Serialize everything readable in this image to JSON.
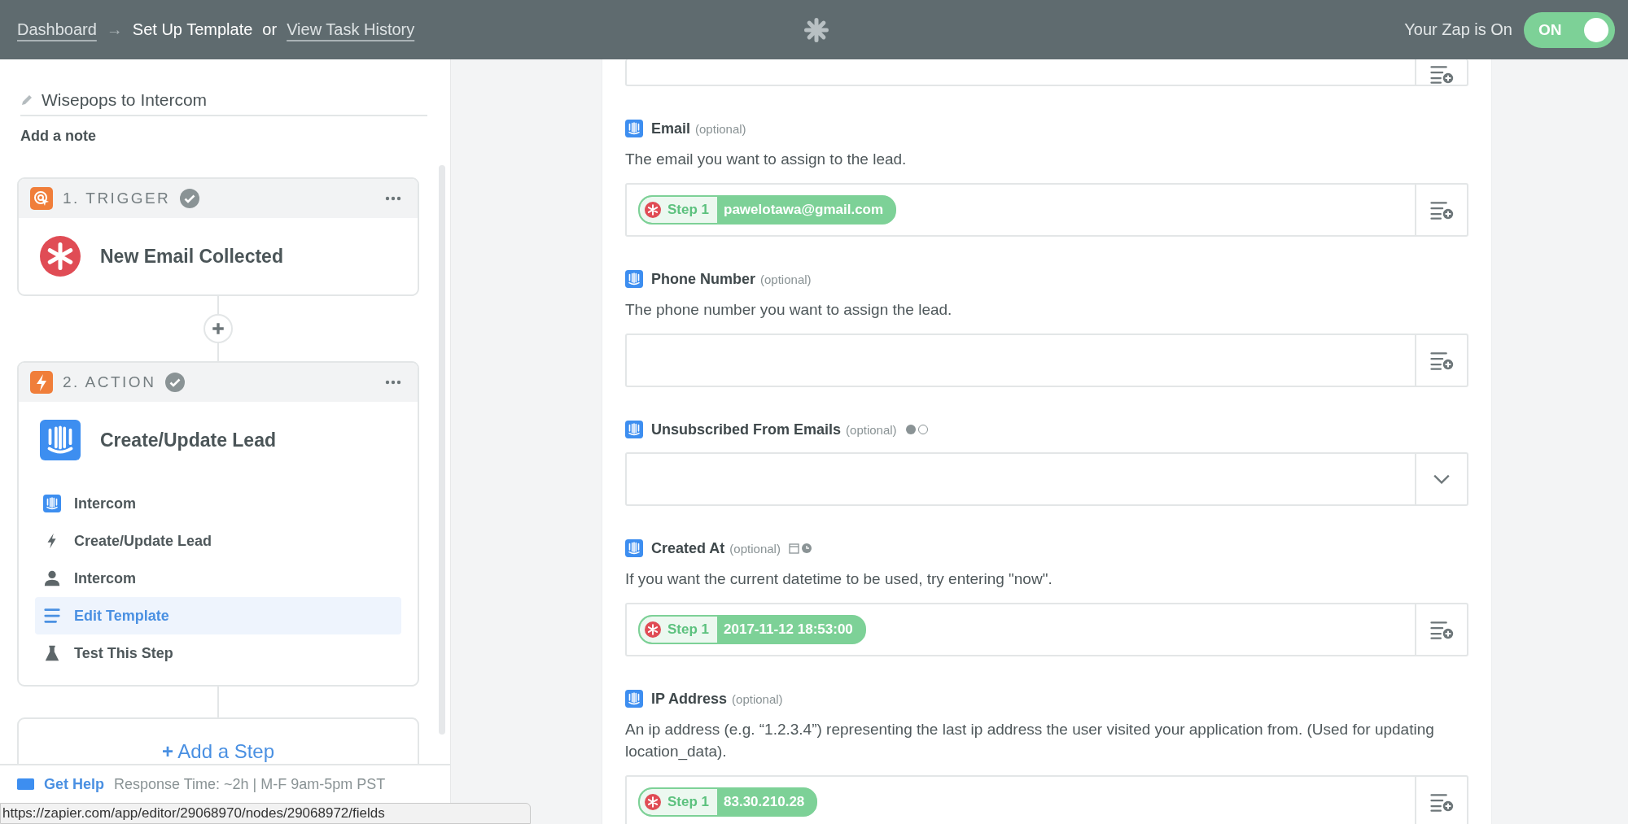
{
  "header": {
    "breadcrumb": [
      {
        "label": "Dashboard",
        "kind": "link"
      },
      {
        "label": "→",
        "kind": "separator"
      },
      {
        "label": "Set Up Template",
        "kind": "current"
      },
      {
        "label": "or",
        "kind": "text"
      },
      {
        "label": "View Task History",
        "kind": "link"
      }
    ],
    "status_label": "Your Zap is On",
    "toggle": {
      "label": "ON",
      "on": true
    }
  },
  "sidebar": {
    "zap_name": "Wisepops to Intercom",
    "note_link": "Add a note",
    "steps": [
      {
        "number_label": "1. TRIGGER",
        "kind": "trigger",
        "complete": true,
        "title": "New Email Collected"
      },
      {
        "number_label": "2. ACTION",
        "kind": "action",
        "complete": true,
        "title": "Create/Update Lead",
        "items": [
          {
            "label": "Intercom",
            "selected": false
          },
          {
            "label": "Create/Update Lead",
            "selected": false
          },
          {
            "label": "Intercom",
            "selected": false
          },
          {
            "label": "Edit Template",
            "selected": true
          },
          {
            "label": "Test This Step",
            "selected": false
          }
        ]
      }
    ],
    "add_step": {
      "icon": "+",
      "label": "Add a Step"
    },
    "help": {
      "link": "Get Help",
      "info": "Response Time: ~2h | M-F 9am-5pm PST"
    }
  },
  "form": {
    "fields": [
      {
        "label": "Email",
        "optional": "(optional)",
        "description": "The email you want to assign to the lead.",
        "kind": "text",
        "value": {
          "step": "Step 1",
          "text": "pawelotawa@gmail.com"
        }
      },
      {
        "label": "Phone Number",
        "optional": "(optional)",
        "description": "The phone number you want to assign the lead.",
        "kind": "text"
      },
      {
        "label": "Unsubscribed From Emails",
        "optional": "(optional)",
        "kind": "select"
      },
      {
        "label": "Created At",
        "optional": "(optional)",
        "description": "If you want the current datetime to be used, try entering \"now\".",
        "kind": "text",
        "value": {
          "step": "Step 1",
          "text": "2017-11-12 18:53:00"
        }
      },
      {
        "label": "IP Address",
        "optional": "(optional)",
        "description": "An ip address (e.g. “1.2.3.4”) representing the last ip address the user visited your application from. (Used for updating location_data).",
        "kind": "text",
        "value": {
          "step": "Step 1",
          "text": "83.30.210.28"
        }
      }
    ]
  },
  "status_url": "https://zapier.com/app/editor/29068970/nodes/29068972/fields"
}
